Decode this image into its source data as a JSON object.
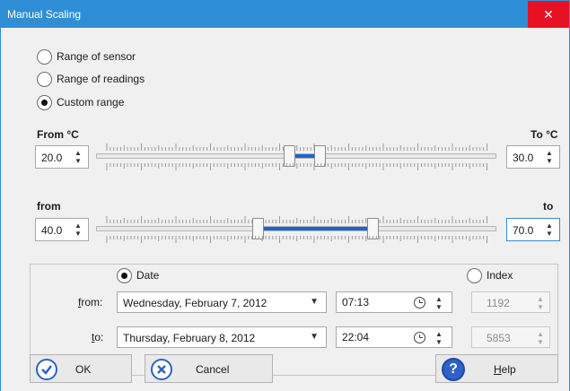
{
  "window": {
    "title": "Manual Scaling",
    "close_glyph": "✕"
  },
  "scale_mode": {
    "options": [
      {
        "label": "Range of sensor",
        "checked": false
      },
      {
        "label": "Range of readings",
        "checked": false
      },
      {
        "label": "Custom range",
        "checked": true
      }
    ]
  },
  "temp_range": {
    "from_label": "From °C",
    "to_label": "To °C",
    "from_value": "20.0",
    "to_value": "30.0"
  },
  "value_range": {
    "from_label": "from",
    "to_label": "to",
    "from_value": "40.0",
    "to_value": "70.0"
  },
  "time_range": {
    "date_option": {
      "label": "Date",
      "checked": true
    },
    "index_option": {
      "label": "Index",
      "checked": false
    },
    "from_label_u": "f",
    "from_label_rest": "rom:",
    "to_label_u": "t",
    "to_label_rest": "o:",
    "from_date": "Wednesday, February 7, 2012",
    "to_date": "Thursday, February 8, 2012",
    "from_time": "07:13",
    "to_time": "22:04",
    "from_index": "1192",
    "to_index": "5853"
  },
  "buttons": {
    "ok": "OK",
    "cancel": "Cancel",
    "help_u": "H",
    "help_rest": "elp"
  },
  "colors": {
    "titlebar": "#2f8fd6",
    "close": "#e81123",
    "range_fill": "#1f65c9"
  }
}
